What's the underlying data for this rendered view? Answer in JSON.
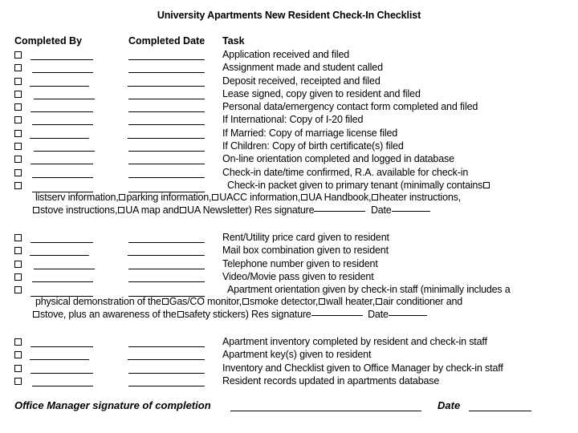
{
  "document": {
    "title": "University Apartments New Resident Check-In Checklist"
  },
  "columns": {
    "completed_by": "Completed By",
    "completed_date": "Completed Date",
    "task": "Task"
  },
  "groups": [
    {
      "id": "group-1",
      "rows": [
        {
          "task": "Application received and filed"
        },
        {
          "task": "Assignment made and student called"
        },
        {
          "task": "Deposit received, receipted and filed"
        },
        {
          "task": "Lease signed, copy given to resident and filed"
        },
        {
          "task": "Personal data/emergency contact form completed and filed"
        },
        {
          "task": "If International: Copy of I-20 filed"
        },
        {
          "task": "If Married: Copy of marriage license filed"
        },
        {
          "task": "If Children:  Copy of birth certificate(s) filed"
        },
        {
          "task": "On-line orientation completed and logged in database"
        },
        {
          "task": "Check-in date/time confirmed, R.A. available for check-in"
        }
      ],
      "paragraph": {
        "lead": "Check-in packet given to primary tenant (minimally contains",
        "line2_a": "listserv information,",
        "line2_b": "parking information,",
        "line2_c": "UACC information,",
        "line2_d": "UA Handbook,",
        "line2_e": "heater instructions,",
        "line3_a": "stove instructions,",
        "line3_b": "UA map and",
        "line3_c": "UA Newsletter)  Res signature",
        "line3_date_label": "Date"
      }
    },
    {
      "id": "group-2",
      "rows": [
        {
          "task": "Rent/Utility price card given to resident"
        },
        {
          "task": "Mail box combination given to resident"
        },
        {
          "task": "Telephone number given to resident"
        },
        {
          "task": "Video/Movie pass given to resident"
        }
      ],
      "paragraph": {
        "lead": "Apartment orientation given by check-in staff (minimally includes a",
        "line2_a": "physical demonstration of the",
        "line2_b": "Gas/CO monitor,",
        "line2_c": "smoke detector,",
        "line2_d": "wall heater,",
        "line2_e": "air conditioner and",
        "line3_a": "stove, plus an awareness of the",
        "line3_b": "safety stickers)  Res signature",
        "line3_date_label": "Date"
      }
    },
    {
      "id": "group-3",
      "rows": [
        {
          "task": "Apartment inventory completed by resident and check-in staff"
        },
        {
          "task": "Apartment key(s) given to resident"
        },
        {
          "task": "Inventory and Checklist given to Office Manager by check-in staff"
        },
        {
          "task": "Resident records updated in apartments database"
        }
      ]
    }
  ],
  "footer": {
    "label": "Office Manager signature of completion",
    "date_label": "Date"
  }
}
